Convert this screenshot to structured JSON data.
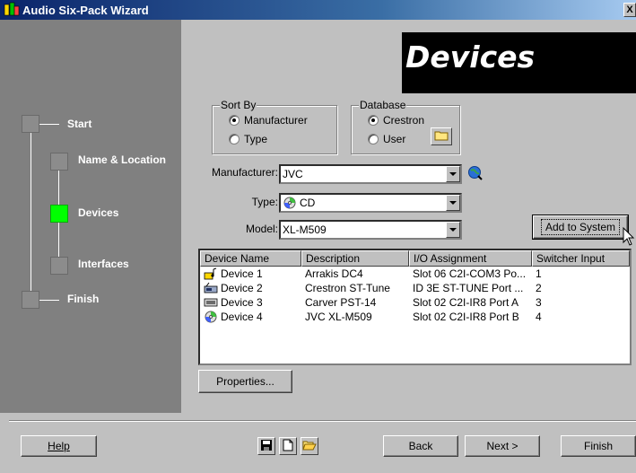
{
  "window": {
    "title": "Audio Six-Pack Wizard",
    "close_glyph": "X"
  },
  "header": {
    "title": "Devices"
  },
  "nav": {
    "steps": [
      {
        "label": "Start",
        "active": false
      },
      {
        "label": "Name & Location",
        "active": false
      },
      {
        "label": "Devices",
        "active": true
      },
      {
        "label": "Interfaces",
        "active": false
      },
      {
        "label": "Finish",
        "active": false
      }
    ],
    "active_color": "#00ff00"
  },
  "sort_by": {
    "legend": "Sort By",
    "options": [
      "Manufacturer",
      "Type"
    ],
    "selected": "Manufacturer"
  },
  "database": {
    "legend": "Database",
    "options": [
      "Crestron",
      "User"
    ],
    "selected": "Crestron"
  },
  "form": {
    "manufacturer_label": "Manufacturer:",
    "manufacturer_value": "JVC",
    "type_label": "Type:",
    "type_value": "CD",
    "model_label": "Model:",
    "model_value": "XL-M509"
  },
  "buttons": {
    "add_to_system": "Add to System",
    "properties": "Properties...",
    "help": "Help",
    "back": "Back",
    "next": "Next >",
    "finish": "Finish"
  },
  "device_list": {
    "columns": [
      "Device Name",
      "Description",
      "I/O Assignment",
      "Switcher Input"
    ],
    "rows": [
      {
        "name": "Device 1",
        "description": "Arrakis DC4",
        "io": "Slot 06 C2I-COM3 Po...",
        "switcher": "1",
        "icon": "audio-device-icon"
      },
      {
        "name": "Device 2",
        "description": "Crestron ST-Tune",
        "io": "ID 3E ST-TUNE Port ...",
        "switcher": "2",
        "icon": "tuner-icon"
      },
      {
        "name": "Device 3",
        "description": "Carver PST-14",
        "io": "Slot 02 C2I-IR8 Port A",
        "switcher": "3",
        "icon": "ir-device-icon"
      },
      {
        "name": "Device 4",
        "description": "JVC XL-M509",
        "io": "Slot 02 C2I-IR8 Port B",
        "switcher": "4",
        "icon": "cd-icon"
      }
    ]
  }
}
